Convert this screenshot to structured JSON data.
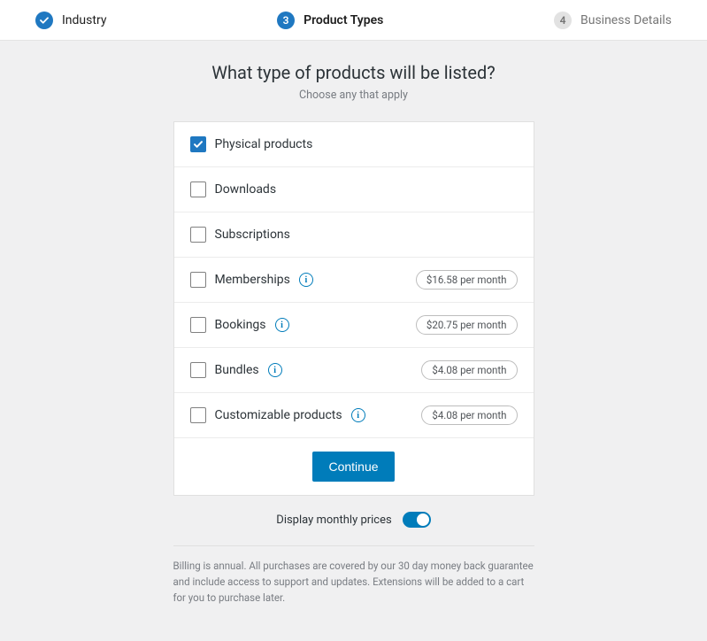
{
  "stepper": {
    "steps": [
      {
        "label": "Industry",
        "state": "done",
        "number": ""
      },
      {
        "label": "Product Types",
        "state": "active",
        "number": "3"
      },
      {
        "label": "Business Details",
        "state": "future",
        "number": "4"
      }
    ]
  },
  "heading": {
    "title": "What type of products will be listed?",
    "subtitle": "Choose any that apply"
  },
  "products": [
    {
      "key": "physical",
      "label": "Physical products",
      "checked": true,
      "info": false,
      "price": null
    },
    {
      "key": "downloads",
      "label": "Downloads",
      "checked": false,
      "info": false,
      "price": null
    },
    {
      "key": "subscriptions",
      "label": "Subscriptions",
      "checked": false,
      "info": false,
      "price": null
    },
    {
      "key": "memberships",
      "label": "Memberships",
      "checked": false,
      "info": true,
      "price": "$16.58 per month"
    },
    {
      "key": "bookings",
      "label": "Bookings",
      "checked": false,
      "info": true,
      "price": "$20.75 per month"
    },
    {
      "key": "bundles",
      "label": "Bundles",
      "checked": false,
      "info": true,
      "price": "$4.08 per month"
    },
    {
      "key": "customizable",
      "label": "Customizable products",
      "checked": false,
      "info": true,
      "price": "$4.08 per month"
    }
  ],
  "buttons": {
    "continue": "Continue"
  },
  "toggle": {
    "label": "Display monthly prices",
    "on": true
  },
  "fine_print": "Billing is annual. All purchases are covered by our 30 day money back guarantee and include access to support and updates. Extensions will be added to a cart for you to purchase later.",
  "icons": {
    "info_glyph": "i"
  }
}
